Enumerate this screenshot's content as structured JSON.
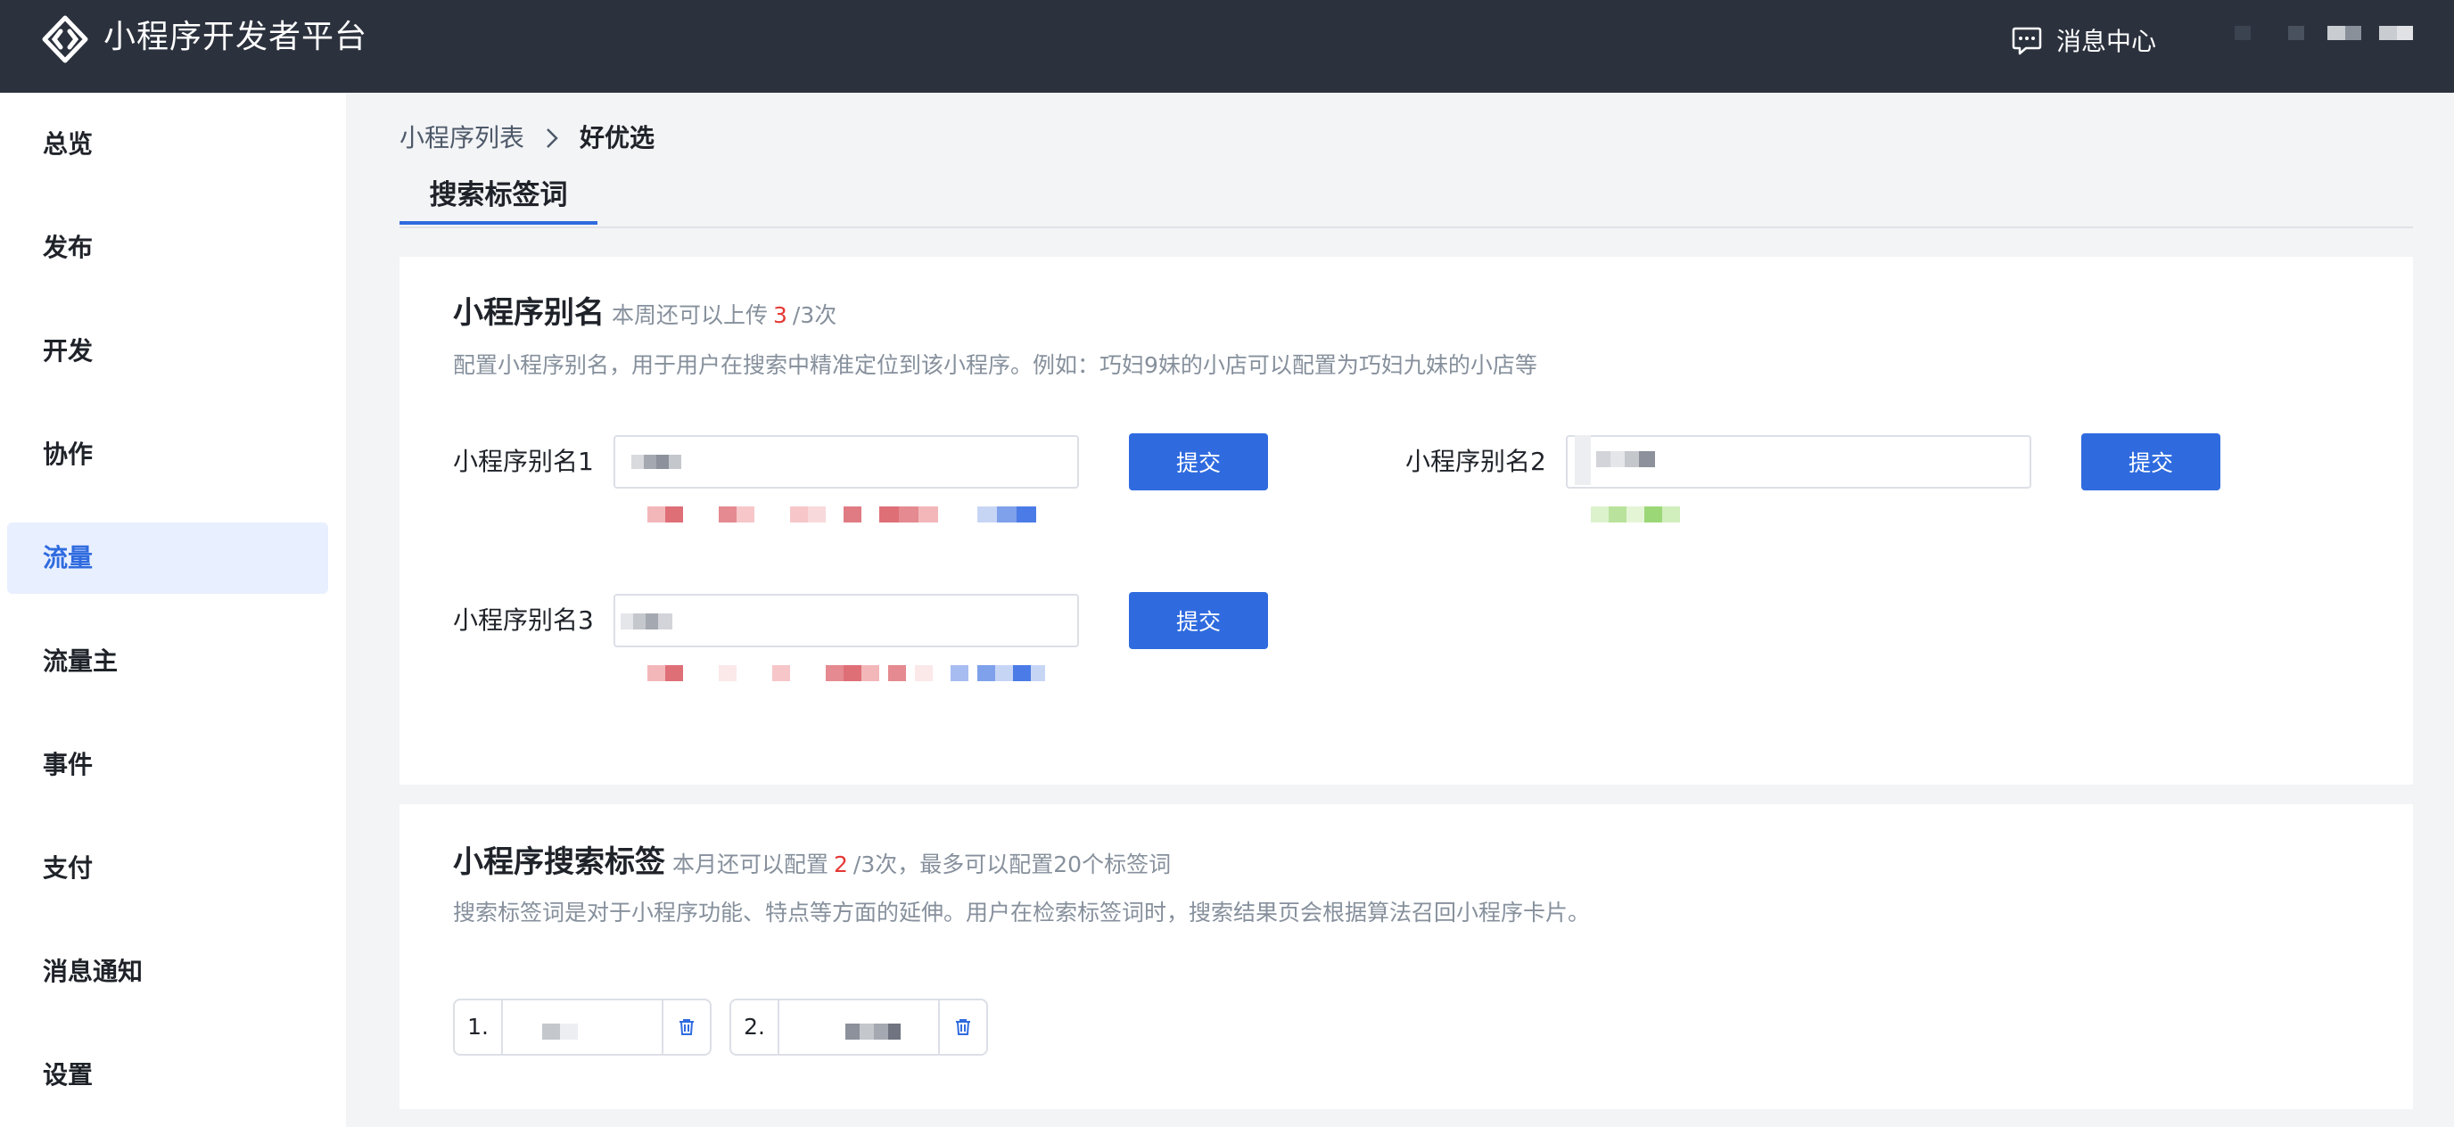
{
  "header": {
    "app_title": "小程序开发者平台",
    "message_center": "消息中心"
  },
  "sidebar": {
    "items": [
      {
        "label": "总览"
      },
      {
        "label": "发布"
      },
      {
        "label": "开发"
      },
      {
        "label": "协作"
      },
      {
        "label": "流量",
        "active": true
      },
      {
        "label": "流量主"
      },
      {
        "label": "事件"
      },
      {
        "label": "支付"
      },
      {
        "label": "消息通知"
      },
      {
        "label": "设置"
      }
    ]
  },
  "breadcrumb": {
    "parent": "小程序列表",
    "current": "好优选"
  },
  "tabs": [
    {
      "label": "搜索标签词",
      "active": true
    }
  ],
  "alias_section": {
    "title": "小程序别名",
    "quota_prefix": "本周还可以上传",
    "quota_count": "3",
    "quota_suffix": "/3次",
    "description": "配置小程序别名，用于用户在搜索中精准定位到该小程序。例如：巧妇9妹的小店可以配置为巧妇九妹的小店等",
    "fields": [
      {
        "label": "小程序别名1",
        "submit": "提交"
      },
      {
        "label": "小程序别名2",
        "submit": "提交"
      },
      {
        "label": "小程序别名3",
        "submit": "提交"
      }
    ]
  },
  "tag_section": {
    "title": "小程序搜索标签",
    "quota_prefix": "本月还可以配置",
    "quota_count": "2",
    "quota_suffix": "/3次，最多可以配置20个标签词",
    "description": "搜索标签词是对于小程序功能、特点等方面的延伸。用户在检索标签词时，搜索结果页会根据算法召回小程序卡片。",
    "tags": [
      {
        "index": "1."
      },
      {
        "index": "2."
      }
    ]
  },
  "colors": {
    "header_bg": "#2b313d",
    "primary": "#2f6bdf",
    "active_nav_bg": "#e8efff",
    "quota_red": "#e53935"
  }
}
